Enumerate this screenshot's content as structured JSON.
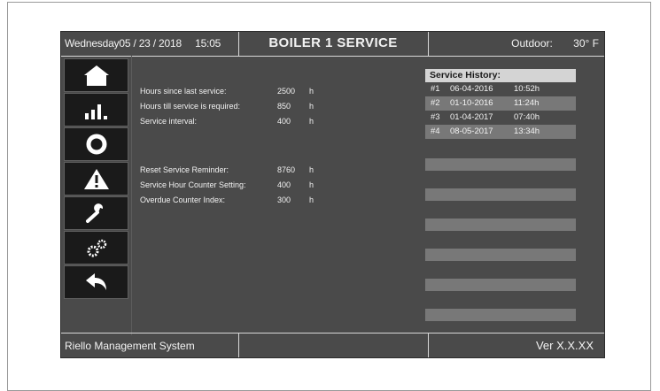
{
  "header": {
    "day": "Wednesday",
    "date": "05 / 23 / 2018",
    "time": "15:05",
    "title": "BOILER 1 SERVICE",
    "outdoor_label": "Outdoor:",
    "outdoor_value": "30",
    "outdoor_unit": "° F"
  },
  "sidebar": {
    "items": [
      {
        "icon": "home-icon"
      },
      {
        "icon": "bar-chart-icon"
      },
      {
        "icon": "ring-icon"
      },
      {
        "icon": "warning-icon"
      },
      {
        "icon": "wrench-icon"
      },
      {
        "icon": "gears-icon"
      },
      {
        "icon": "back-arrow-icon"
      }
    ]
  },
  "params": [
    {
      "label": "Hours since last service:",
      "value": "2500",
      "unit": "h"
    },
    {
      "label": "Hours till service is required:",
      "value": "850",
      "unit": "h"
    },
    {
      "label": "Service interval:",
      "value": "400",
      "unit": "h"
    },
    {
      "label": "Reset Service Reminder:",
      "value": "8760",
      "unit": "h"
    },
    {
      "label": "Service Hour Counter Setting:",
      "value": "400",
      "unit": "h"
    },
    {
      "label": "Overdue Counter Index:",
      "value": "300",
      "unit": "h"
    }
  ],
  "history": {
    "title": "Service History:",
    "rows": [
      {
        "num": "#1",
        "date": "06-04-2016",
        "hours": "10:52h"
      },
      {
        "num": "#2",
        "date": "01-10-2016",
        "hours": "11:24h"
      },
      {
        "num": "#3",
        "date": "01-04-2017",
        "hours": "07:40h"
      },
      {
        "num": "#4",
        "date": "08-05-2017",
        "hours": "13:34h"
      }
    ]
  },
  "footer": {
    "app_name": "Riello Management System",
    "version": "Ver X.X.XX"
  },
  "colors": {
    "screen_bg": "#4a4a4a",
    "button_bg": "#1a1a1a",
    "history_header": "#d4d4d4",
    "row_alt": "#787878",
    "text": "#f2f2f2"
  }
}
